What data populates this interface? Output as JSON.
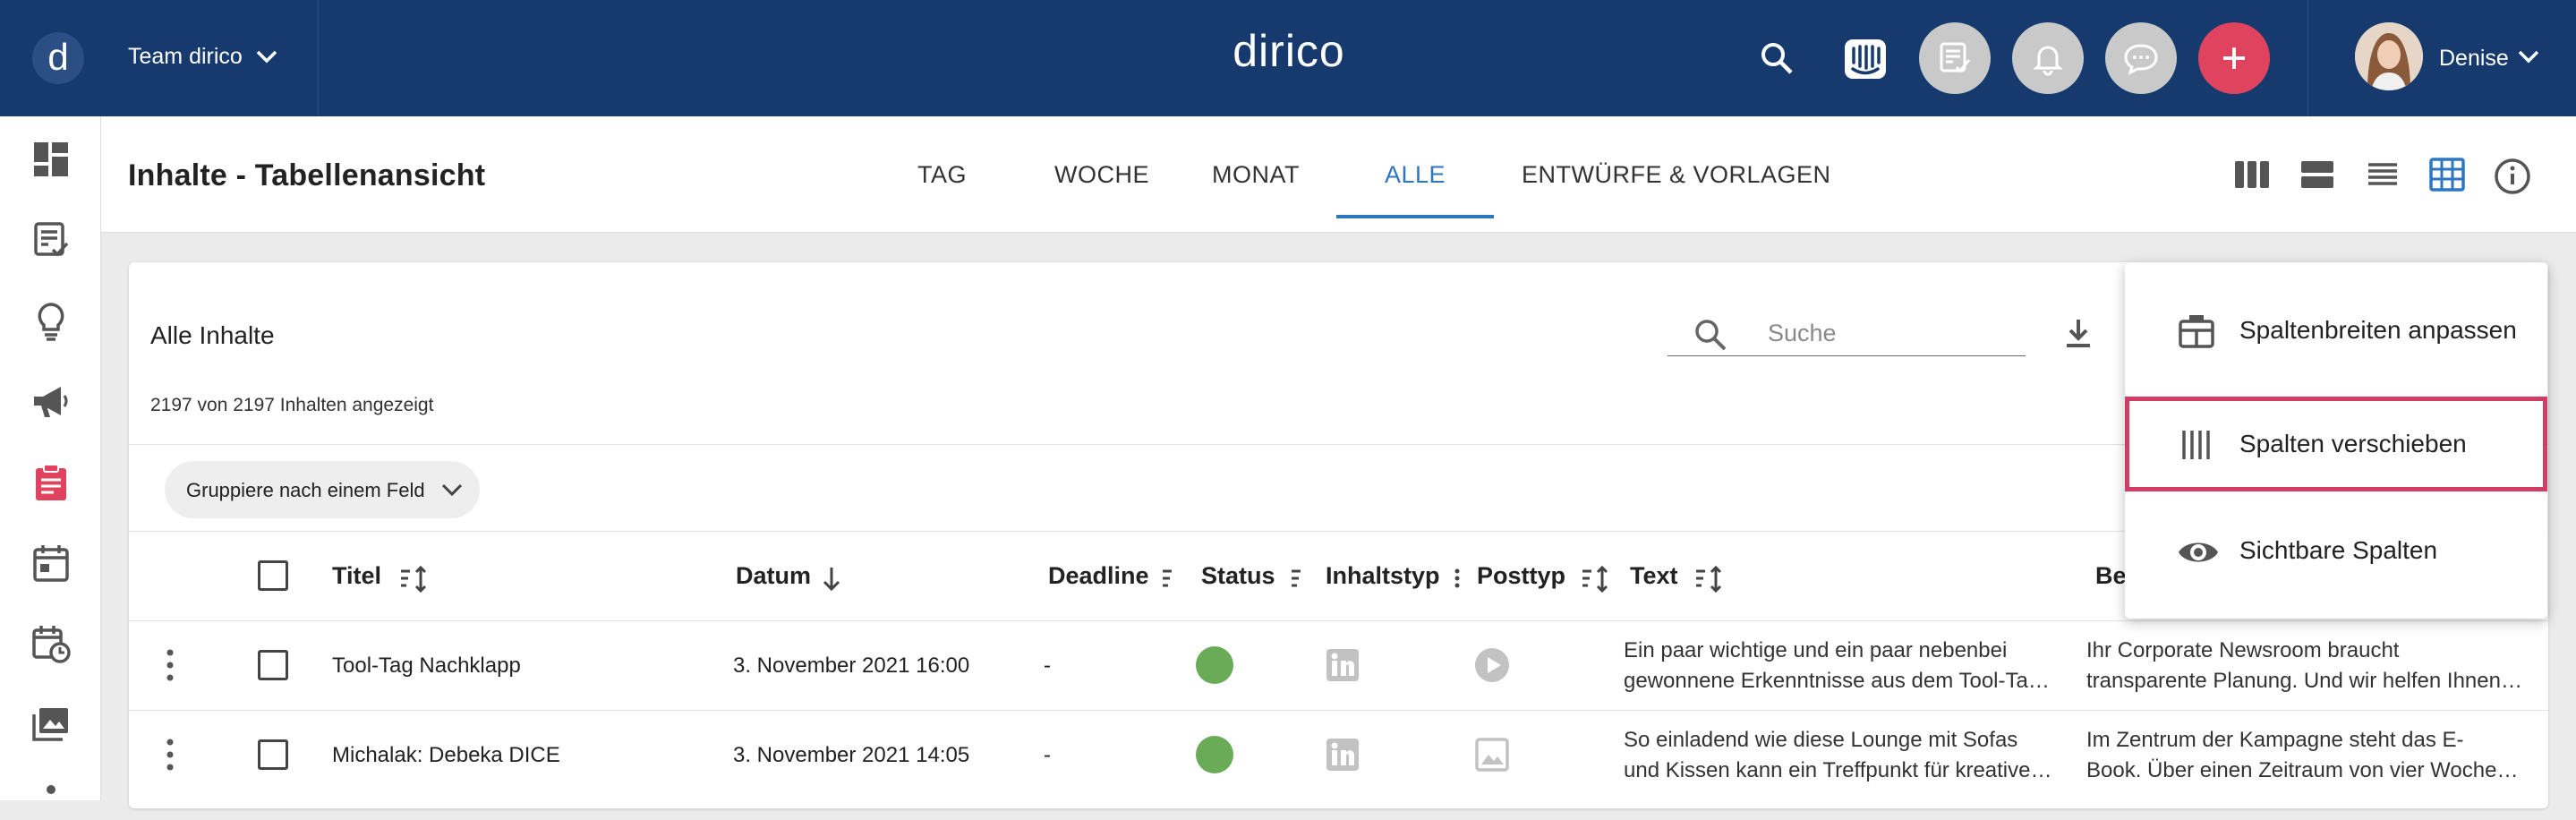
{
  "topbar": {
    "logo_letter": "d",
    "team_name": "Team dirico",
    "brand": "dirico",
    "user_name": "Denise",
    "accent_add": "#e0435d",
    "bar_color": "#163a6e"
  },
  "header": {
    "title": "Inhalte - Tabellenansicht",
    "tabs": [
      {
        "label": "TAG"
      },
      {
        "label": "WOCHE"
      },
      {
        "label": "MONAT"
      },
      {
        "label": "ALLE",
        "active": true
      },
      {
        "label": "ENTWÜRFE & VORLAGEN"
      }
    ],
    "view_icons": [
      "columns-view-icon",
      "rows-view-icon",
      "list-view-icon",
      "table-view-icon",
      "info-icon"
    ]
  },
  "content": {
    "title": "Alle Inhalte",
    "count_text": "2197 von 2197 Inhalten angezeigt",
    "search_placeholder": "Suche",
    "search_value": "",
    "group_label": "Gruppiere nach einem Feld"
  },
  "table": {
    "columns": [
      "Titel",
      "Datum",
      "Deadline",
      "Status",
      "Inhaltstyp",
      "Posttyp",
      "Text",
      "Be"
    ],
    "rows": [
      {
        "title": "Tool-Tag Nachklapp",
        "date": "3. November 2021 16:00",
        "deadline": "-",
        "status_color": "#6aab57",
        "content_type_icon": "linkedin-icon",
        "post_type_icon": "video-icon",
        "text_line1": "Ein paar wichtige und ein paar nebenbei",
        "text_line2": "gewonnene Erkenntnisse aus dem Tool-Ta…",
        "desc_line1": "Ihr Corporate Newsroom braucht",
        "desc_line2": "transparente Planung. Und wir helfen Ihnen…"
      },
      {
        "title": "Michalak: Debeka DICE",
        "date": "3. November 2021 14:05",
        "deadline": "-",
        "status_color": "#6aab57",
        "content_type_icon": "linkedin-icon",
        "post_type_icon": "image-icon",
        "text_line1": "So einladend wie diese Lounge mit Sofas",
        "text_line2": "und Kissen kann ein Treffpunkt für kreative…",
        "desc_line1": "Im Zentrum der Kampagne steht das E-",
        "desc_line2": "Book. Über einen Zeitraum von vier Woche…"
      }
    ]
  },
  "menu": {
    "items": [
      {
        "label": "Spaltenbreiten anpassen",
        "icon": "table-columns-icon"
      },
      {
        "label": "Spalten verschieben",
        "icon": "move-columns-icon",
        "highlighted": true
      },
      {
        "label": "Sichtbare Spalten",
        "icon": "eye-icon"
      }
    ],
    "highlight_color": "#d23c66"
  }
}
